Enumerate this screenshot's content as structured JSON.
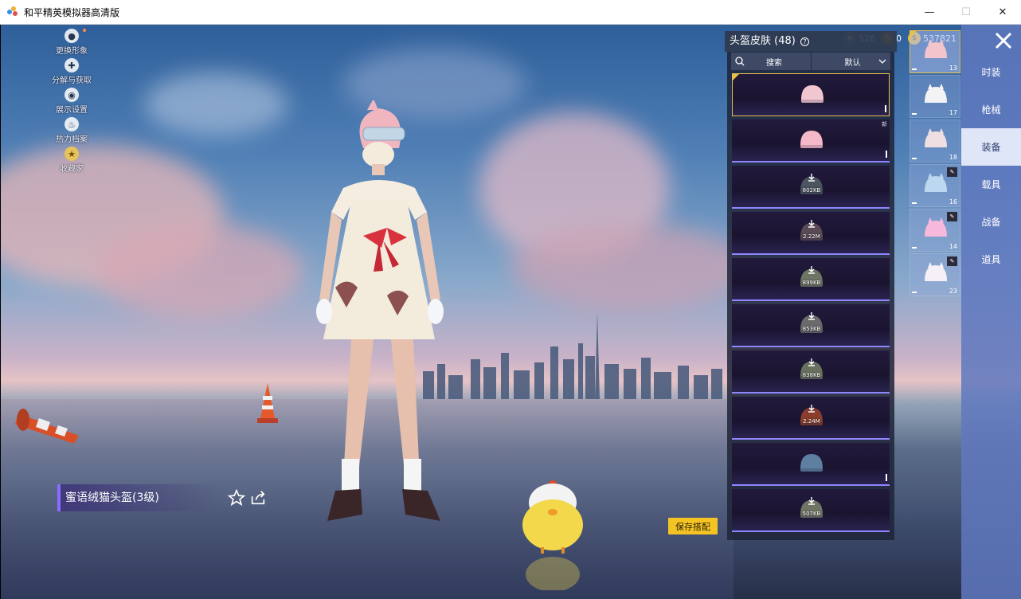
{
  "window": {
    "title": "和平精英模拟器高清版",
    "controls": [
      "minimize",
      "maximize",
      "close"
    ]
  },
  "currency": [
    {
      "icon": "coin-icon",
      "value": "528"
    },
    {
      "icon": "medal-icon",
      "value": "0"
    },
    {
      "icon": "gold-coin-icon",
      "value": "537821"
    }
  ],
  "left_menu": [
    {
      "label": "更换形象",
      "icon": "avatar-icon",
      "dot": true
    },
    {
      "label": "分解与获取",
      "icon": "puzzle-icon"
    },
    {
      "label": "展示设置",
      "icon": "eye-icon"
    },
    {
      "label": "热力档案",
      "icon": "flame-icon"
    },
    {
      "label": "收藏家",
      "icon": "collector-badge-icon"
    }
  ],
  "item": {
    "name": "蜜语绒猫头盔(3级)",
    "save_label": "保存搭配"
  },
  "panel": {
    "title": "头盔皮肤 (48)",
    "search_label": "搜索",
    "sort_label": "默认",
    "skins": [
      {
        "size": "",
        "selected": true,
        "new": false,
        "color": "#f1c7cf"
      },
      {
        "size": "",
        "selected": false,
        "new": true,
        "color": "#f4b8c8"
      },
      {
        "size": "802KB",
        "selected": false,
        "new": false,
        "color": "#4b5560"
      },
      {
        "size": "2.22M",
        "selected": false,
        "new": false,
        "color": "#5a4a55"
      },
      {
        "size": "899KB",
        "selected": false,
        "new": false,
        "color": "#6d7565"
      },
      {
        "size": "853KB",
        "selected": false,
        "new": false,
        "color": "#6a6a6a"
      },
      {
        "size": "838KB",
        "selected": false,
        "new": false,
        "color": "#68705e"
      },
      {
        "size": "2.24M",
        "selected": false,
        "new": false,
        "color": "#8a3d2d"
      },
      {
        "size": "",
        "selected": false,
        "new": false,
        "color": "#5f7fa0"
      },
      {
        "size": "507KB",
        "selected": false,
        "new": false,
        "color": "#707465"
      }
    ]
  },
  "thumbnails": [
    {
      "count": "13",
      "selected": true,
      "badge": false,
      "color": "#f2c5cd"
    },
    {
      "count": "17",
      "selected": false,
      "badge": false,
      "color": "#f3f3f6"
    },
    {
      "count": "18",
      "selected": false,
      "badge": false,
      "color": "#f0dfe2"
    },
    {
      "count": "16",
      "selected": false,
      "badge": true,
      "color": "#bcd7f0"
    },
    {
      "count": "14",
      "selected": false,
      "badge": true,
      "color": "#f6b9dc"
    },
    {
      "count": "23",
      "selected": false,
      "badge": true,
      "color": "#f5f0f5"
    }
  ],
  "categories": [
    {
      "label": "时装",
      "active": false
    },
    {
      "label": "枪械",
      "active": false
    },
    {
      "label": "装备",
      "active": true
    },
    {
      "label": "载具",
      "active": false
    },
    {
      "label": "战备",
      "active": false
    },
    {
      "label": "道具",
      "active": false
    }
  ]
}
